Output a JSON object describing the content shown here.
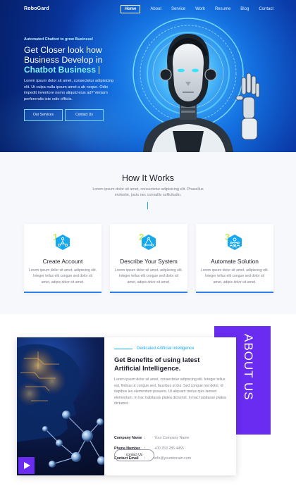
{
  "nav": {
    "logo": "RoboGard",
    "items": [
      "Home",
      "About",
      "Service",
      "Work",
      "Resume",
      "Blog",
      "Contact"
    ]
  },
  "hero": {
    "tagline": "Automated Chatbot to grow Business!",
    "headline_1": "Get Closer look how",
    "headline_2": "Business Develop in",
    "headline_3": "Chatbot Business",
    "description": "Lorem ipsum dolor sit amet, consectetur adipisicing elit. Ut culpa nulla ipsum amet a ab neque. Odio impedit inventore nemo aliquid eius ad? Veniam perferendis iste odio officiis.",
    "btn_services": "Our Services",
    "btn_contact": "Contact Us"
  },
  "how": {
    "title": "How It Works",
    "subtitle": "Lorem ipsum dolor sit amet, consectetur adipisicing elit. Phasellus molestie, justo nec convallis sollicitudin.",
    "cards": [
      {
        "num": "1",
        "title": "Create Account",
        "desc": "Lorem ipsum dolor sit amet, adipiscing elit. Integer tellus elit congue sed dolor sit amet, adipis dolor sit amet.",
        "icon": "network-icon"
      },
      {
        "num": "2",
        "title": "Describe Your System",
        "desc": "Lorem ipsum dolor sit amet, adipiscing elit. Integer tellus elit congue sed dolor sit amet, adipis dolor sit amet.",
        "icon": "triangle-nodes-icon"
      },
      {
        "num": "3",
        "title": "Automate Solution",
        "desc": "Lorem ipsum dolor sit amet, adipiscing elit. Integer tellus elit congue sed dolor sit amet, adipis dolor sit amet.",
        "icon": "team-icon"
      }
    ]
  },
  "about": {
    "vertical_label": "ABOUT US",
    "pre_title": "Dedicated Artificial Intelligence",
    "heading_1": "Get Benefits of using latest",
    "heading_2": "Artificial Intelligence.",
    "description": "Lorem ipsum dolor sit amet, consectetur adipiscing elit. Integer tellus est, finibus ut congue sed, faucibus ut dui. Sed congue nisi dolor, id dapibus leo elementum posuere. Ut aliquam metus quis laoreet elementum. In hac habitasse platea dictumst. In hac habitasse platea dictumst.",
    "contact": [
      {
        "label": "Company Name",
        "value": "Your Company Name"
      },
      {
        "label": "Phone Number",
        "value": "+00 253 285 4455"
      },
      {
        "label": "Contact Email",
        "value": "info@yourdomain.com"
      }
    ],
    "button": "contact Us"
  },
  "colors": {
    "accent_blue": "#18a8f0",
    "purple": "#6a2cf0",
    "hero_cyan": "#7ff0ff",
    "card_number": "#c8e85a"
  }
}
